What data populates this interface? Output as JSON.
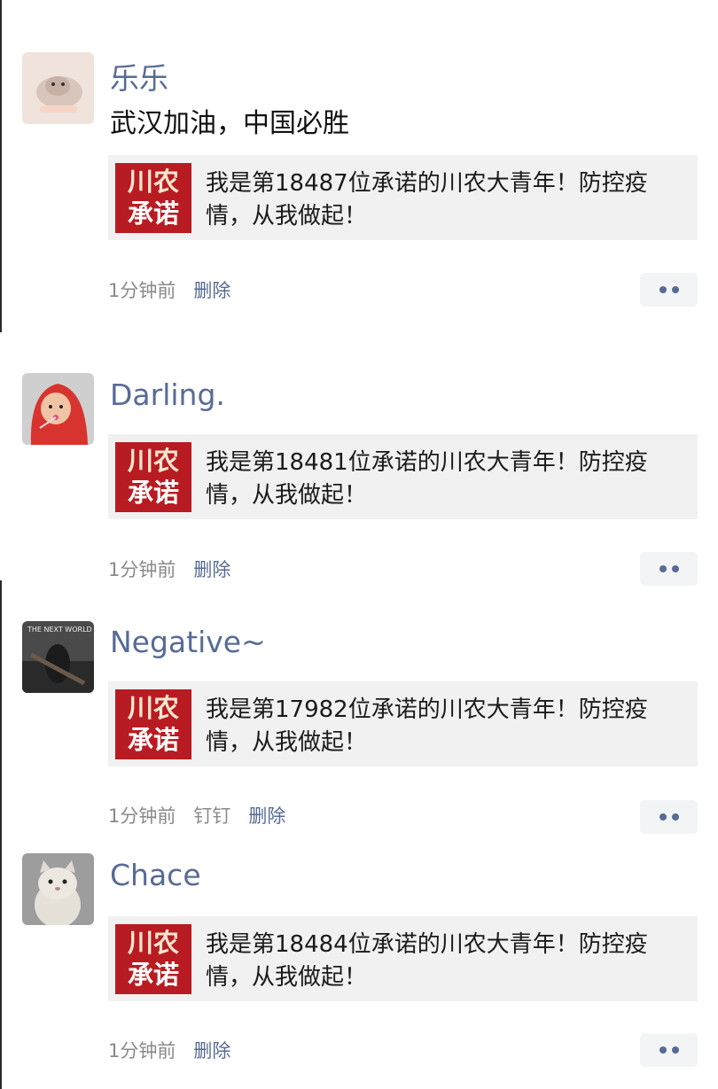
{
  "posts": [
    {
      "name": "乐乐",
      "text": "武汉加油，中国必胜",
      "card": {
        "logo_line1": "川农",
        "logo_line2": "承诺",
        "text": "我是第18487位承诺的川农大青年！防控疫情，从我做起！"
      },
      "time": "1分钟前",
      "tag": "",
      "delete": "删除",
      "avatar_icon": "hamster-avatar-icon"
    },
    {
      "name": "Darling.",
      "text": "",
      "card": {
        "logo_line1": "川农",
        "logo_line2": "承诺",
        "text": "我是第18481位承诺的川农大青年！防控疫情，从我做起！"
      },
      "time": "1分钟前",
      "tag": "",
      "delete": "删除",
      "avatar_icon": "child-red-hood-avatar-icon"
    },
    {
      "name": "Negative~",
      "text": "",
      "card": {
        "logo_line1": "川农",
        "logo_line2": "承诺",
        "text": "我是第17982位承诺的川农大青年！防控疫情，从我做起！"
      },
      "time": "1分钟前",
      "tag": "钉钉",
      "delete": "删除",
      "avatar_icon": "the-next-world-avatar-icon",
      "avatar_text": "THE NEXT WORLD"
    },
    {
      "name": "Chace",
      "text": "",
      "card": {
        "logo_line1": "川农",
        "logo_line2": "承诺",
        "text": "我是第18484位承诺的川农大青年！防控疫情，从我做起！"
      },
      "time": "1分钟前",
      "tag": "",
      "delete": "删除",
      "avatar_icon": "cat-avatar-icon"
    }
  ],
  "colors": {
    "name": "#576b95",
    "logo_red": "#b81c22",
    "card_bg": "#f1f1f1"
  }
}
